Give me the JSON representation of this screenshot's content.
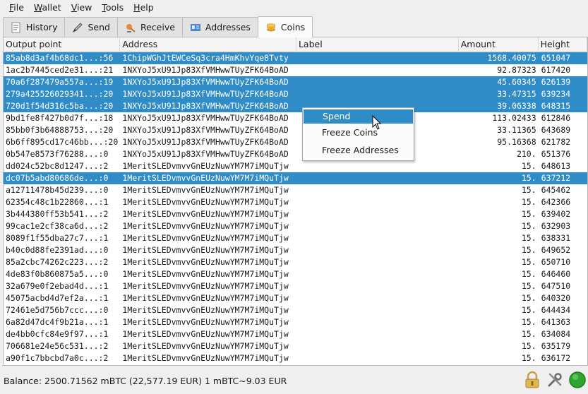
{
  "menu": [
    {
      "u": "F",
      "rest": "ile"
    },
    {
      "u": "W",
      "rest": "allet"
    },
    {
      "u": "V",
      "rest": "iew"
    },
    {
      "u": "T",
      "rest": "ools"
    },
    {
      "u": "H",
      "rest": "elp"
    }
  ],
  "tabs": [
    {
      "label": "History",
      "icon": "history-icon"
    },
    {
      "label": "Send",
      "icon": "send-icon"
    },
    {
      "label": "Receive",
      "icon": "receive-icon"
    },
    {
      "label": "Addresses",
      "icon": "addresses-icon"
    },
    {
      "label": "Coins",
      "icon": "coins-icon",
      "active": true
    }
  ],
  "table": {
    "columns": [
      "Output point",
      "Address",
      "Label",
      "Amount",
      "Height"
    ],
    "rows": [
      {
        "op": "85ab8d3af4b68dc1...:56",
        "addr": "1ChipWGhJtEWCeSq3cra4HmKhvYqe8Tvty",
        "label": "",
        "amount": "1568.40075",
        "height": "651047",
        "selected": true
      },
      {
        "op": "1ac2b7445ced2e31...:21",
        "addr": "1NXYoJ5xU91Jp83XfVMHwwTUyZFK64BoAD",
        "label": "",
        "amount": "92.87323",
        "height": "617420",
        "selected": false
      },
      {
        "op": "70a6f287479a557a...:19",
        "addr": "1NXYoJ5xU91Jp83XfVMHwwTUyZFK64BoAD",
        "label": "",
        "amount": "45.60345",
        "height": "626139",
        "selected": true
      },
      {
        "op": "279a425526029341...:20",
        "addr": "1NXYoJ5xU91Jp83XfVMHwwTUyZFK64BoAD",
        "label": "",
        "amount": "33.47315",
        "height": "639234",
        "selected": true
      },
      {
        "op": "720d1f54d316c5ba...:20",
        "addr": "1NXYoJ5xU91Jp83XfVMHwwTUyZFK64BoAD",
        "label": "",
        "amount": "39.06338",
        "height": "648315",
        "selected": true
      },
      {
        "op": "9bd1fe8f427b0d7f...:18",
        "addr": "1NXYoJ5xU91Jp83XfVMHwwTUyZFK64BoAD",
        "label": "",
        "amount": "113.02433",
        "height": "612846",
        "selected": false
      },
      {
        "op": "85bb0f3b64888753...:20",
        "addr": "1NXYoJ5xU91Jp83XfVMHwwTUyZFK64BoAD",
        "label": "",
        "amount": "33.11365",
        "height": "643689",
        "selected": false
      },
      {
        "op": "6b6ff895cd17c46bb...:20",
        "addr": "1NXYoJ5xU91Jp83XfVMHwwTUyZFK64BoAD",
        "label": "",
        "amount": "95.16368",
        "height": "621782",
        "selected": false
      },
      {
        "op": "0b547e8573f76288...:0",
        "addr": "1NXYoJ5xU91Jp83XfVMHwwTUyZFK64BoAD",
        "label": "",
        "amount": "210.",
        "height": "651376",
        "selected": false
      },
      {
        "op": "dd024c52bc8d1247...:2",
        "addr": "1MeritSLEDvmvvGnEUzNuwYM7M7iMQuTjw",
        "label": "",
        "amount": "15.",
        "height": "648613",
        "selected": false
      },
      {
        "op": "dc07b5abd80686de...:0",
        "addr": "1MeritSLEDvmvvGnEUzNuwYM7M7iMQuTjw",
        "label": "",
        "amount": "15.",
        "height": "637212",
        "selected": true
      },
      {
        "op": "a12711478b45d239...:0",
        "addr": "1MeritSLEDvmvvGnEUzNuwYM7M7iMQuTjw",
        "label": "",
        "amount": "15.",
        "height": "645462",
        "selected": false
      },
      {
        "op": "62354c48c1b22860...:1",
        "addr": "1MeritSLEDvmvvGnEUzNuwYM7M7iMQuTjw",
        "label": "",
        "amount": "15.",
        "height": "642366",
        "selected": false
      },
      {
        "op": "3b444380ff53b541...:2",
        "addr": "1MeritSLEDvmvvGnEUzNuwYM7M7iMQuTjw",
        "label": "",
        "amount": "15.",
        "height": "639402",
        "selected": false
      },
      {
        "op": "99cac1e2cf38ca6d...:2",
        "addr": "1MeritSLEDvmvvGnEUzNuwYM7M7iMQuTjw",
        "label": "",
        "amount": "15.",
        "height": "632903",
        "selected": false
      },
      {
        "op": "8089f1f55dba27c7...:1",
        "addr": "1MeritSLEDvmvvGnEUzNuwYM7M7iMQuTjw",
        "label": "",
        "amount": "15.",
        "height": "638331",
        "selected": false
      },
      {
        "op": "b40c0d88fe2391ad...:0",
        "addr": "1MeritSLEDvmvvGnEUzNuwYM7M7iMQuTjw",
        "label": "",
        "amount": "15.",
        "height": "649652",
        "selected": false
      },
      {
        "op": "85a2cbc74262c223...:2",
        "addr": "1MeritSLEDvmvvGnEUzNuwYM7M7iMQuTjw",
        "label": "",
        "amount": "15.",
        "height": "650710",
        "selected": false
      },
      {
        "op": "4de83f0b860875a5...:0",
        "addr": "1MeritSLEDvmvvGnEUzNuwYM7M7iMQuTjw",
        "label": "",
        "amount": "15.",
        "height": "646460",
        "selected": false
      },
      {
        "op": "32a679e0f2ebad4d...:1",
        "addr": "1MeritSLEDvmvvGnEUzNuwYM7M7iMQuTjw",
        "label": "",
        "amount": "15.",
        "height": "647510",
        "selected": false
      },
      {
        "op": "45075acbd4d7ef2a...:1",
        "addr": "1MeritSLEDvmvvGnEUzNuwYM7M7iMQuTjw",
        "label": "",
        "amount": "15.",
        "height": "640320",
        "selected": false
      },
      {
        "op": "72461e5d756b7ccc...:0",
        "addr": "1MeritSLEDvmvvGnEUzNuwYM7M7iMQuTjw",
        "label": "",
        "amount": "15.",
        "height": "644434",
        "selected": false
      },
      {
        "op": "6a82d47dc4f9b21a...:1",
        "addr": "1MeritSLEDvmvvGnEUzNuwYM7M7iMQuTjw",
        "label": "",
        "amount": "15.",
        "height": "641363",
        "selected": false
      },
      {
        "op": "de4bb0cfc84e9f97...:1",
        "addr": "1MeritSLEDvmvvGnEUzNuwYM7M7iMQuTjw",
        "label": "",
        "amount": "15.",
        "height": "634084",
        "selected": false
      },
      {
        "op": "706681e24e56c531...:2",
        "addr": "1MeritSLEDvmvvGnEUzNuwYM7M7iMQuTjw",
        "label": "",
        "amount": "15.",
        "height": "635179",
        "selected": false
      },
      {
        "op": "a90f1c7bbcbd7a0c...:2",
        "addr": "1MeritSLEDvmvvGnEUzNuwYM7M7iMQuTjw",
        "label": "",
        "amount": "15.",
        "height": "636172",
        "selected": false
      }
    ]
  },
  "context_menu": {
    "items": [
      {
        "label": "Spend",
        "highlighted": true
      },
      {
        "label": "Freeze Coins",
        "highlighted": false
      },
      {
        "label": "Freeze Addresses",
        "highlighted": false
      }
    ]
  },
  "status": {
    "text": "Balance: 2500.71562 mBTC (22,577.19 EUR)  1 mBTC~9.03 EUR",
    "icons": [
      "lock-icon",
      "tools-icon",
      "network-status-icon"
    ]
  },
  "colors": {
    "selection": "#308cc6",
    "status_ok": "#2ea52e"
  }
}
